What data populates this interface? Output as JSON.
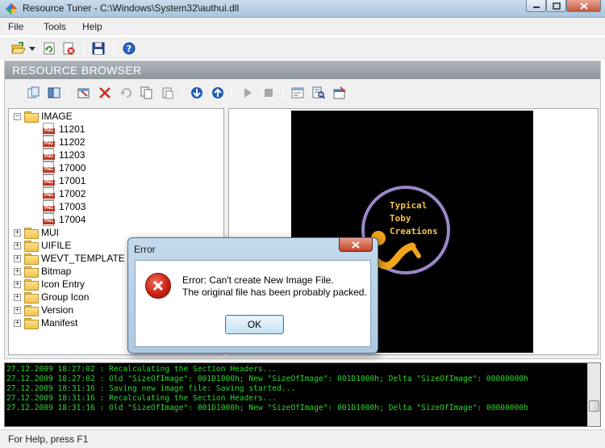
{
  "window": {
    "title": "Resource Tuner - C:\\Windows\\System32\\authui.dll"
  },
  "menu": {
    "file": "File",
    "tools": "Tools",
    "help": "Help"
  },
  "browser": {
    "header": "RESOURCE BROWSER"
  },
  "tree": {
    "image_label": "IMAGE",
    "image_items": [
      "11201",
      "11202",
      "11203",
      "17000",
      "17001",
      "17002",
      "17003",
      "17004"
    ],
    "folders": [
      "MUI",
      "UIFILE",
      "WEVT_TEMPLATE",
      "Bitmap",
      "Icon Entry",
      "Group Icon",
      "Version",
      "Manifest"
    ]
  },
  "preview": {
    "logo_text": "Typical Toby Creations"
  },
  "dialog": {
    "title": "Error",
    "line1": "Error: Can't create New Image File.",
    "line2": "The original file has been probably packed.",
    "ok_label": "OK"
  },
  "log": {
    "lines": [
      "27.12.2009 18:27:02 : Recalculating the Section Headers...",
      "27.12.2009 18:27:02 : Old \"SizeOfImage\": 001D1000h; New \"SizeOfImage\": 001D1000h; Delta \"SizeOfImage\": 00000000h",
      "27.12.2009 18:31:16 : Saving new image file: Saving started...",
      "27.12.2009 18:31:16 : Recalculating the Section Headers...",
      "27.12.2009 18:31:16 : Old \"SizeOfImage\": 001D1000h; New \"SizeOfImage\": 001D1000h; Delta \"SizeOfImage\": 00000000h"
    ]
  },
  "status": {
    "text": "For Help, press F1"
  }
}
